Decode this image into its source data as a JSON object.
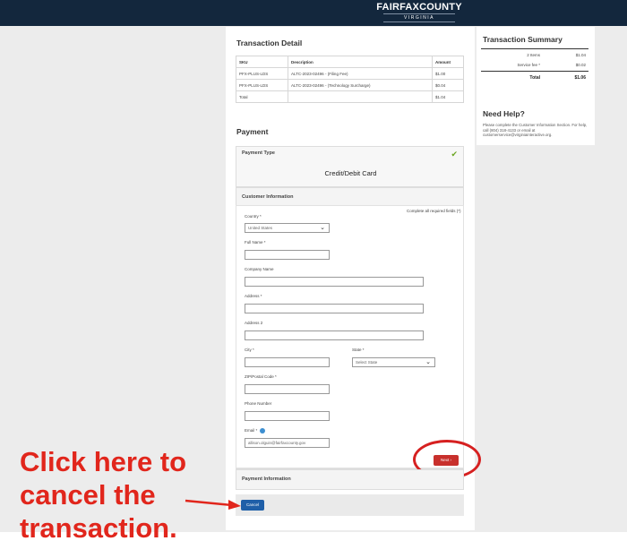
{
  "header": {
    "logo_main": "FAIRFAXCOUNTY",
    "logo_sub": "VIRGINIA"
  },
  "transaction_detail": {
    "title": "Transaction Detail",
    "columns": [
      "SKU",
      "Description",
      "Amount"
    ],
    "rows": [
      [
        "PFX-PLUS-LDS",
        "ALTC-2023-02496 - (Filing Fee)",
        "$1.00"
      ],
      [
        "PFX-PLUS-LDS",
        "ALTC-2023-02496 - (Technology Surcharge)",
        "$0.04"
      ],
      [
        "Total",
        "",
        "$1.04"
      ]
    ]
  },
  "payment": {
    "title": "Payment",
    "payment_type_label": "Payment Type",
    "payment_type_value": "Credit/Debit Card",
    "customer_info_label": "Customer Information",
    "required_note": "Complete all required fields (*)",
    "fields": {
      "country_label": "Country *",
      "country_value": "United States",
      "full_name_label": "Full Name *",
      "company_label": "Company Name",
      "address_label": "Address *",
      "address2_label": "Address 2",
      "city_label": "City *",
      "state_label": "State *",
      "state_value": "Select State",
      "zip_label": "ZIP/Postal Code *",
      "phone_label": "Phone Number",
      "email_label": "Email *",
      "email_value": "allison.olguin@fairfaxcounty.gov"
    },
    "next_label": "Next",
    "payment_info_label": "Payment Information",
    "cancel_label": "Cancel"
  },
  "summary": {
    "title": "Transaction Summary",
    "items_label": "2 Items",
    "items_value": "$1.04",
    "fee_label": "Service fee *",
    "fee_value": "$0.02",
    "total_label": "Total",
    "total_value": "$1.06"
  },
  "help": {
    "title": "Need Help?",
    "text": "Please complete the Customer Information Section. For help, call (804) 318-4133 or email at customerservice@virginiainteractive.org."
  },
  "annotation": {
    "text": "Click here to cancel the transaction."
  },
  "colors": {
    "header_bg": "#13273d",
    "next_button": "#c8302c",
    "cancel_button": "#1f5fa8",
    "annotation_red": "#e1261c",
    "check_green": "#6aa520"
  }
}
